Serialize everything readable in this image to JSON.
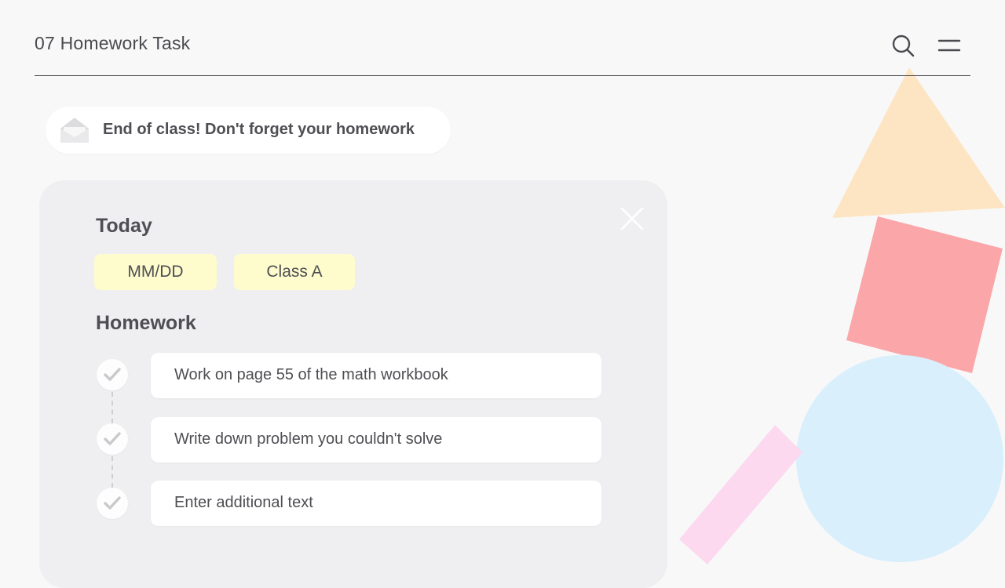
{
  "header": {
    "title": "07 Homework Task",
    "search_icon": "search-icon",
    "menu_icon": "menu-icon"
  },
  "notice": {
    "icon": "envelope-icon",
    "text": "End of class! Don't forget your homework"
  },
  "panel": {
    "close_icon": "close-icon",
    "today_title": "Today",
    "tags": {
      "date": "MM/DD",
      "class": "Class A"
    },
    "homework_title": "Homework",
    "tasks": [
      {
        "text": "Work on page 55 of the math workbook"
      },
      {
        "text": "Write down problem you couldn't solve"
      },
      {
        "text": "Enter additional text"
      }
    ]
  },
  "colors": {
    "background": "#f8f8f9",
    "panel": "#efeff1",
    "tag": "#fefccd",
    "text": "#4a4a4f",
    "triangle": "#fde5c3",
    "square": "#fba6a8",
    "circle": "#d9effc",
    "bar": "#fcd9ef"
  }
}
